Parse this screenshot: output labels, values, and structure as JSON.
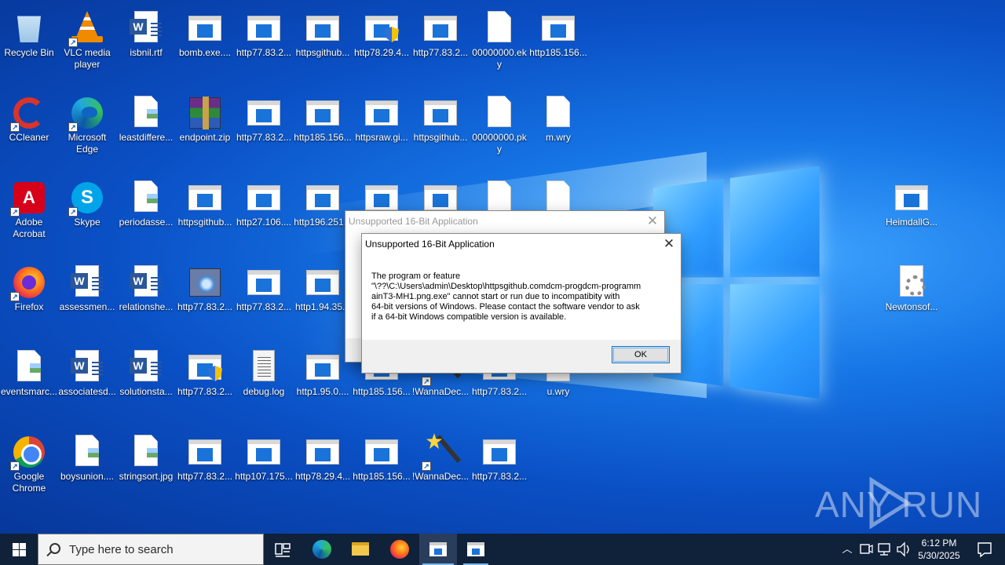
{
  "desktop": {
    "icons": [
      {
        "label": "Recycle Bin",
        "type": "recycle"
      },
      {
        "label": "VLC media player",
        "type": "vlc",
        "shortcut": true
      },
      {
        "label": "isbnil.rtf",
        "type": "word"
      },
      {
        "label": "bomb.exe....",
        "type": "win"
      },
      {
        "label": "http77.83.2...",
        "type": "win"
      },
      {
        "label": "httpsgithub...",
        "type": "win"
      },
      {
        "label": "http78.29.4...",
        "type": "win-shield"
      },
      {
        "label": "http77.83.2...",
        "type": "win"
      },
      {
        "label": "00000000.eky",
        "type": "file"
      },
      {
        "label": "http185.156...",
        "type": "win"
      },
      {
        "label": "CCleaner",
        "type": "ccleaner",
        "shortcut": true
      },
      {
        "label": "Microsoft Edge",
        "type": "edge",
        "shortcut": true
      },
      {
        "label": "leastdiffere...",
        "type": "img"
      },
      {
        "label": "endpoint.zip",
        "type": "zip"
      },
      {
        "label": "http77.83.2...",
        "type": "win"
      },
      {
        "label": "http185.156...",
        "type": "win"
      },
      {
        "label": "httpsraw.gi...",
        "type": "win"
      },
      {
        "label": "httpsgithub...",
        "type": "win"
      },
      {
        "label": "00000000.pky",
        "type": "file"
      },
      {
        "label": "m.wry",
        "type": "file"
      },
      {
        "label": "Adobe Acrobat",
        "type": "acrobat",
        "shortcut": true
      },
      {
        "label": "Skype",
        "type": "skype",
        "shortcut": true
      },
      {
        "label": "periodasse...",
        "type": "img"
      },
      {
        "label": "httpsgithub...",
        "type": "win"
      },
      {
        "label": "http27.106....",
        "type": "win"
      },
      {
        "label": "http196.251...",
        "type": "win"
      },
      {
        "label": "",
        "type": "win"
      },
      {
        "label": "",
        "type": "win"
      },
      {
        "label": "",
        "type": "file"
      },
      {
        "label": "",
        "type": "file"
      },
      {
        "label": "Firefox",
        "type": "firefox",
        "shortcut": true
      },
      {
        "label": "assessmen...",
        "type": "word"
      },
      {
        "label": "relationshe...",
        "type": "word"
      },
      {
        "label": "http77.83.2...",
        "type": "setup"
      },
      {
        "label": "http77.83.2...",
        "type": "win"
      },
      {
        "label": "http1.94.35...",
        "type": "win"
      },
      {
        "label": "eventsmarc...",
        "type": "img"
      },
      {
        "label": "associatesd...",
        "type": "word"
      },
      {
        "label": "solutionsta...",
        "type": "word"
      },
      {
        "label": "http77.83.2...",
        "type": "win-shield"
      },
      {
        "label": "debug.log",
        "type": "log"
      },
      {
        "label": "http1.95.0....",
        "type": "win"
      },
      {
        "label": "http185.156...",
        "type": "win"
      },
      {
        "label": "!WannaDec...",
        "type": "wand",
        "shortcut": true
      },
      {
        "label": "http77.83.2...",
        "type": "win"
      },
      {
        "label": "u.wry",
        "type": "file"
      },
      {
        "label": "Google Chrome",
        "type": "chrome",
        "shortcut": true
      },
      {
        "label": "boysunion....",
        "type": "img"
      },
      {
        "label": "stringsort.jpg",
        "type": "img"
      },
      {
        "label": "http77.83.2...",
        "type": "win"
      },
      {
        "label": "http107.175...",
        "type": "win"
      },
      {
        "label": "http78.29.4...",
        "type": "win"
      },
      {
        "label": "http185.156...",
        "type": "win"
      },
      {
        "label": "!WannaDec...",
        "type": "wand",
        "shortcut": true
      },
      {
        "label": "http77.83.2...",
        "type": "win"
      },
      {
        "label": "HeimdallG...",
        "type": "win"
      },
      {
        "label": "Newtonsof...",
        "type": "gear"
      }
    ]
  },
  "dialog_back": {
    "title": "Unsupported 16-Bit Application"
  },
  "dialog_front": {
    "title": "Unsupported 16-Bit Application",
    "message_line1": "The program or feature",
    "message_line2": "\"\\??\\C:\\Users\\admin\\Desktop\\httpsgithub.comdcm-progdcm-programm",
    "message_line3": "ainT3-MH1.png.exe\" cannot start or run due to incompatibity with",
    "message_line4": "64-bit versions of Windows. Please contact the software vendor to ask",
    "message_line5": "if a 64-bit Windows compatible version is available.",
    "ok_label": "OK"
  },
  "watermark": {
    "text": "ANY RUN"
  },
  "taskbar": {
    "search_placeholder": "Type here to search",
    "time": "6:12 PM",
    "date": "5/30/2025"
  },
  "colors": {
    "desktop_accent": "#0a64d8",
    "taskbar": "#10213a",
    "dialog_ok_border": "#0078d7"
  }
}
